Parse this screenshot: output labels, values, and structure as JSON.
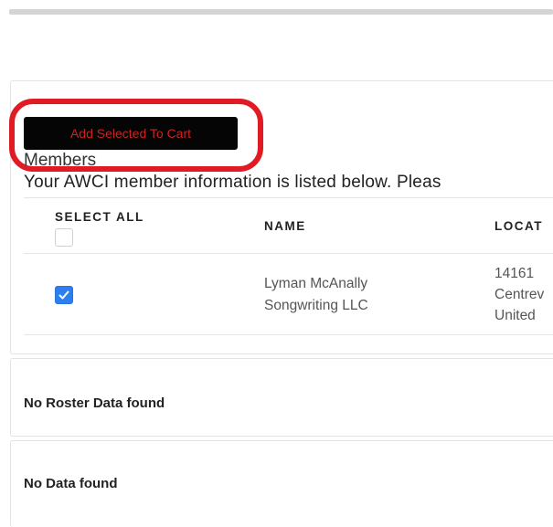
{
  "members_section": {
    "add_to_cart_label": "Add Selected To Cart",
    "heading": "Members",
    "intro": "Your AWCI member information is listed below. Pleas",
    "table": {
      "headers": {
        "select_all": "SELECT ALL",
        "name": "NAME",
        "location": "LOCAT"
      },
      "select_all_checked": false,
      "rows": [
        {
          "checked": true,
          "name_line1": "Lyman McAnally",
          "name_line2": "Songwriting LLC",
          "location_line1": "14161",
          "location_line2": "Centrev",
          "location_line3": "United"
        }
      ]
    }
  },
  "roster_section": {
    "message": "No Roster Data found"
  },
  "data_section": {
    "message": "No Data found"
  },
  "colors": {
    "button_bg": "#050505",
    "button_text": "#cc2222",
    "highlight_ring": "#e01b24",
    "checkbox_checked": "#2d7ff0"
  }
}
